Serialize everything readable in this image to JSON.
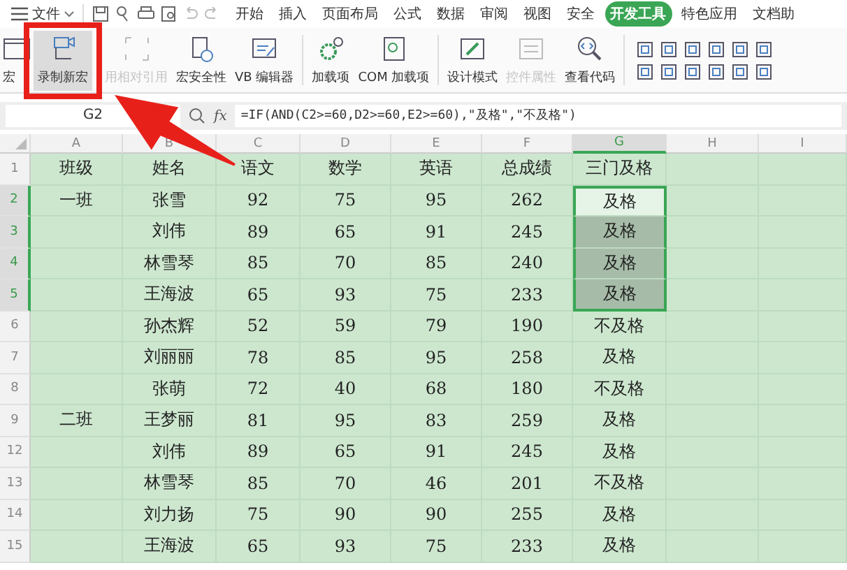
{
  "menu": {
    "file": "文件",
    "tabs": [
      {
        "label": "开始",
        "selected": false
      },
      {
        "label": "插入",
        "selected": false
      },
      {
        "label": "页面布局",
        "selected": false
      },
      {
        "label": "公式",
        "selected": false
      },
      {
        "label": "数据",
        "selected": false
      },
      {
        "label": "审阅",
        "selected": false
      },
      {
        "label": "视图",
        "selected": false
      },
      {
        "label": "安全",
        "selected": false
      },
      {
        "label": "开发工具",
        "selected": true
      },
      {
        "label": "特色应用",
        "selected": false
      },
      {
        "label": "文档助",
        "selected": false
      }
    ]
  },
  "ribbon": {
    "groups": [
      [
        {
          "label": "宏",
          "kind": "macro",
          "selected": false,
          "disabled": false
        },
        {
          "label": "录制新宏",
          "kind": "record",
          "selected": true,
          "disabled": false
        },
        {
          "label": "用相对引用",
          "kind": "relative",
          "selected": false,
          "disabled": true
        },
        {
          "label": "宏安全性",
          "kind": "security",
          "selected": false,
          "disabled": false
        },
        {
          "label": "VB 编辑器",
          "kind": "editor",
          "selected": false,
          "disabled": false
        }
      ],
      [
        {
          "label": "加载项",
          "kind": "addin",
          "selected": false,
          "disabled": false
        },
        {
          "label": "COM 加载项",
          "kind": "com",
          "selected": false,
          "disabled": false
        }
      ],
      [
        {
          "label": "设计模式",
          "kind": "design",
          "selected": false,
          "disabled": false
        },
        {
          "label": "控件属性",
          "kind": "props",
          "selected": false,
          "disabled": true
        },
        {
          "label": "查看代码",
          "kind": "code",
          "selected": false,
          "disabled": false
        }
      ]
    ]
  },
  "formula_bar": {
    "name_box": "G2",
    "fx": "fx",
    "formula": "=IF(AND(C2>=60,D2>=60,E2>=60),\"及格\",\"不及格\")"
  },
  "columns": [
    {
      "label": "A",
      "selected": false
    },
    {
      "label": "B",
      "selected": false
    },
    {
      "label": "C",
      "selected": false
    },
    {
      "label": "D",
      "selected": false
    },
    {
      "label": "E",
      "selected": false
    },
    {
      "label": "F",
      "selected": false
    },
    {
      "label": "G",
      "selected": true
    },
    {
      "label": "H",
      "selected": false
    },
    {
      "label": "I",
      "selected": false
    }
  ],
  "rows": [
    {
      "header": "1",
      "selected": false,
      "active": false,
      "cells": [
        "班级",
        "姓名",
        "语文",
        "数学",
        "英语",
        "总成绩",
        "三门及格"
      ]
    },
    {
      "header": "2",
      "selected": true,
      "active": true,
      "cells": [
        "一班",
        "张雪",
        "92",
        "75",
        "95",
        "262",
        "及格"
      ]
    },
    {
      "header": "3",
      "selected": true,
      "active": false,
      "cells": [
        "",
        "刘伟",
        "89",
        "65",
        "91",
        "245",
        "及格"
      ]
    },
    {
      "header": "4",
      "selected": true,
      "active": false,
      "cells": [
        "",
        "林雪琴",
        "85",
        "70",
        "85",
        "240",
        "及格"
      ]
    },
    {
      "header": "5",
      "selected": true,
      "active": false,
      "cells": [
        "",
        "王海波",
        "65",
        "93",
        "75",
        "233",
        "及格"
      ]
    },
    {
      "header": "6",
      "selected": false,
      "active": false,
      "cells": [
        "",
        "孙杰辉",
        "52",
        "59",
        "79",
        "190",
        "不及格"
      ]
    },
    {
      "header": "7",
      "selected": false,
      "active": false,
      "cells": [
        "",
        "刘丽丽",
        "78",
        "85",
        "95",
        "258",
        "及格"
      ]
    },
    {
      "header": "8",
      "selected": false,
      "active": false,
      "cells": [
        "",
        "张萌",
        "72",
        "40",
        "68",
        "180",
        "不及格"
      ]
    },
    {
      "header": "9",
      "selected": false,
      "active": false,
      "cells": [
        "二班",
        "王梦丽",
        "81",
        "95",
        "83",
        "259",
        "及格"
      ]
    },
    {
      "header": "12",
      "selected": false,
      "active": false,
      "cells": [
        "",
        "刘伟",
        "89",
        "65",
        "91",
        "245",
        "及格"
      ]
    },
    {
      "header": "13",
      "selected": false,
      "active": false,
      "cells": [
        "",
        "林雪琴",
        "85",
        "70",
        "46",
        "201",
        "不及格"
      ]
    },
    {
      "header": "14",
      "selected": false,
      "active": false,
      "cells": [
        "",
        "刘力扬",
        "75",
        "90",
        "90",
        "255",
        "及格"
      ]
    },
    {
      "header": "15",
      "selected": false,
      "active": false,
      "cells": [
        "",
        "王海波",
        "65",
        "93",
        "75",
        "233",
        "及格"
      ]
    }
  ]
}
